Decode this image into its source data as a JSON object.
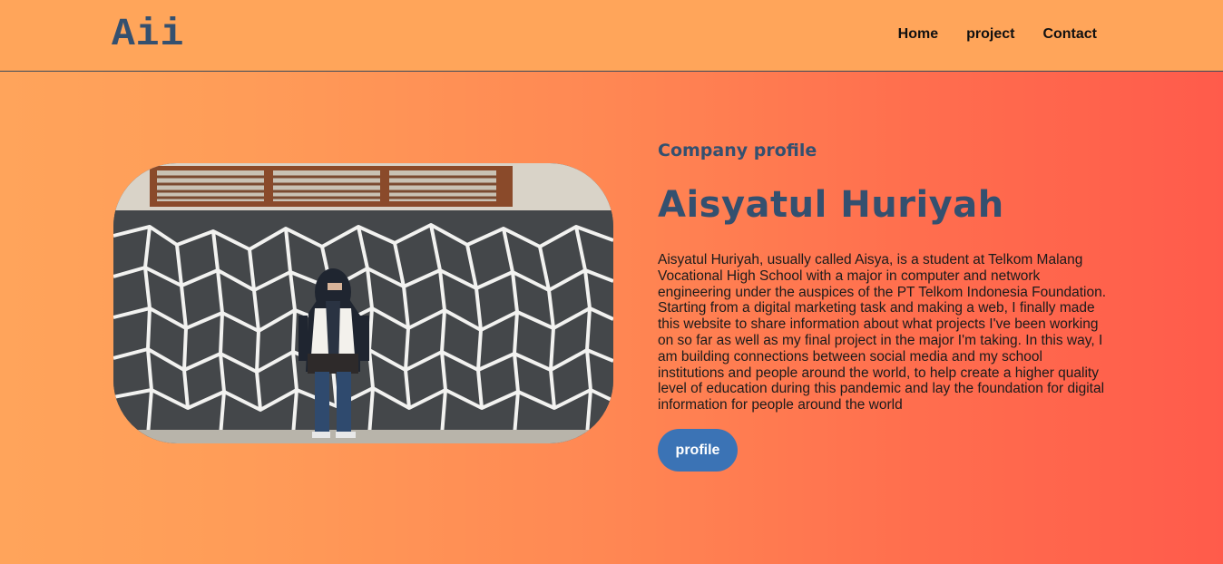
{
  "header": {
    "logo": "Aii",
    "nav": [
      {
        "label": "Home"
      },
      {
        "label": "project"
      },
      {
        "label": "Contact"
      }
    ]
  },
  "hero": {
    "subtitle": "Company profile",
    "name": "Aisyatul Huriyah",
    "description": "Aisyatul Huriyah, usually called Aisya, is a student at Telkom Malang Vocational High School with a major in computer and network engineering under the auspices of the PT Telkom Indonesia Foundation. Starting from a digital marketing task and making a web, I finally made this website to share information about what projects I've been working on so far as well as my final project in the major I'm taking. In this way, I am building connections between social media and my school institutions and people around the world, to help create a higher quality level of education during this pandemic and lay the foundation for digital information for people around the world",
    "button_label": "profile"
  },
  "colors": {
    "nav_bg": "#ffa55a",
    "accent": "#34506f",
    "button": "#3b73b5",
    "gradient_start": "#ffa45b",
    "gradient_end": "#ff5b4b"
  }
}
